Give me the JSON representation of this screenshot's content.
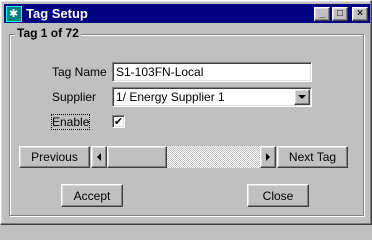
{
  "window": {
    "title": "Tag Setup",
    "controls": {
      "minimize": "_",
      "maximize": "□",
      "close": "×"
    }
  },
  "group": {
    "title": "Tag  1 of  72"
  },
  "form": {
    "tag_name_label": "Tag Name",
    "tag_name_value": "S1-103FN-Local",
    "supplier_label": "Supplier",
    "supplier_value": "1/ Energy Supplier 1",
    "enable_label": "Enable",
    "enable_checked": true,
    "check_mark": "✔"
  },
  "navigation": {
    "previous_label": "Previous",
    "next_label": "Next Tag",
    "scroll_position": 1,
    "scroll_total": 72
  },
  "actions": {
    "accept_label": "Accept",
    "close_label": "Close"
  },
  "colors": {
    "titlebar": "#000080",
    "face": "#c0c0c0"
  }
}
